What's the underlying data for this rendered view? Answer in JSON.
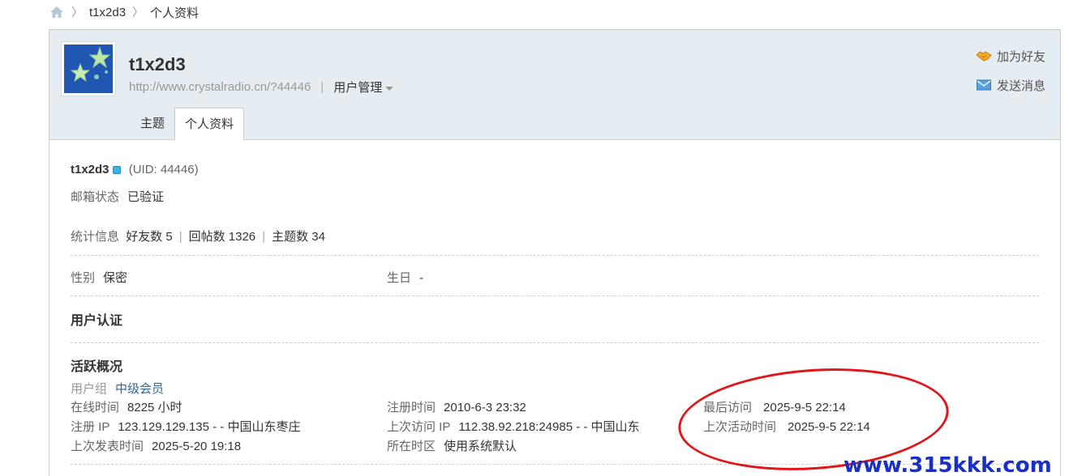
{
  "breadcrumb": {
    "user": "t1x2d3",
    "page": "个人资料"
  },
  "header": {
    "username": "t1x2d3",
    "url": "http://www.crystalradio.cn/?44446",
    "manage": "用户管理",
    "add_friend": "加为好友",
    "send_message": "发送消息",
    "tabs": [
      "主题",
      "个人资料"
    ]
  },
  "profile": {
    "name": "t1x2d3",
    "uid": "(UID: 44446)",
    "email_label": "邮箱状态",
    "email_value": "已验证",
    "stats_label": "统计信息",
    "friends": "好友数 5",
    "posts": "回帖数 1326",
    "threads": "主题数 34",
    "gender_label": "性别",
    "gender_value": "保密",
    "birthday_label": "生日",
    "birthday_value": "-",
    "auth_title": "用户认证",
    "activity_title": "活跃概况",
    "group_label": "用户组",
    "group_value": "中级会员",
    "online_label": "在线时间",
    "online_value": "8225 小时",
    "reg_time_label": "注册时间",
    "reg_time_value": "2010-6-3 23:32",
    "last_visit_label": "最后访问",
    "last_visit_value": "2025-9-5 22:14",
    "reg_ip_label": "注册 IP",
    "reg_ip_value": "123.129.129.135 - - 中国山东枣庄",
    "last_ip_label": "上次访问 IP",
    "last_ip_value": "112.38.92.218:24985 - - 中国山东",
    "last_active_label": "上次活动时间",
    "last_active_value": "2025-9-5 22:14",
    "last_post_label": "上次发表时间",
    "last_post_value": "2025-5-20 19:18",
    "timezone_label": "所在时区",
    "timezone_value": "使用系统默认"
  },
  "watermark": "www.315kkk.com",
  "colors": {
    "header_bg": "#e5edf2",
    "link": "#336699",
    "annotation": "#e0161a",
    "watermark": "#1a2fc4"
  }
}
